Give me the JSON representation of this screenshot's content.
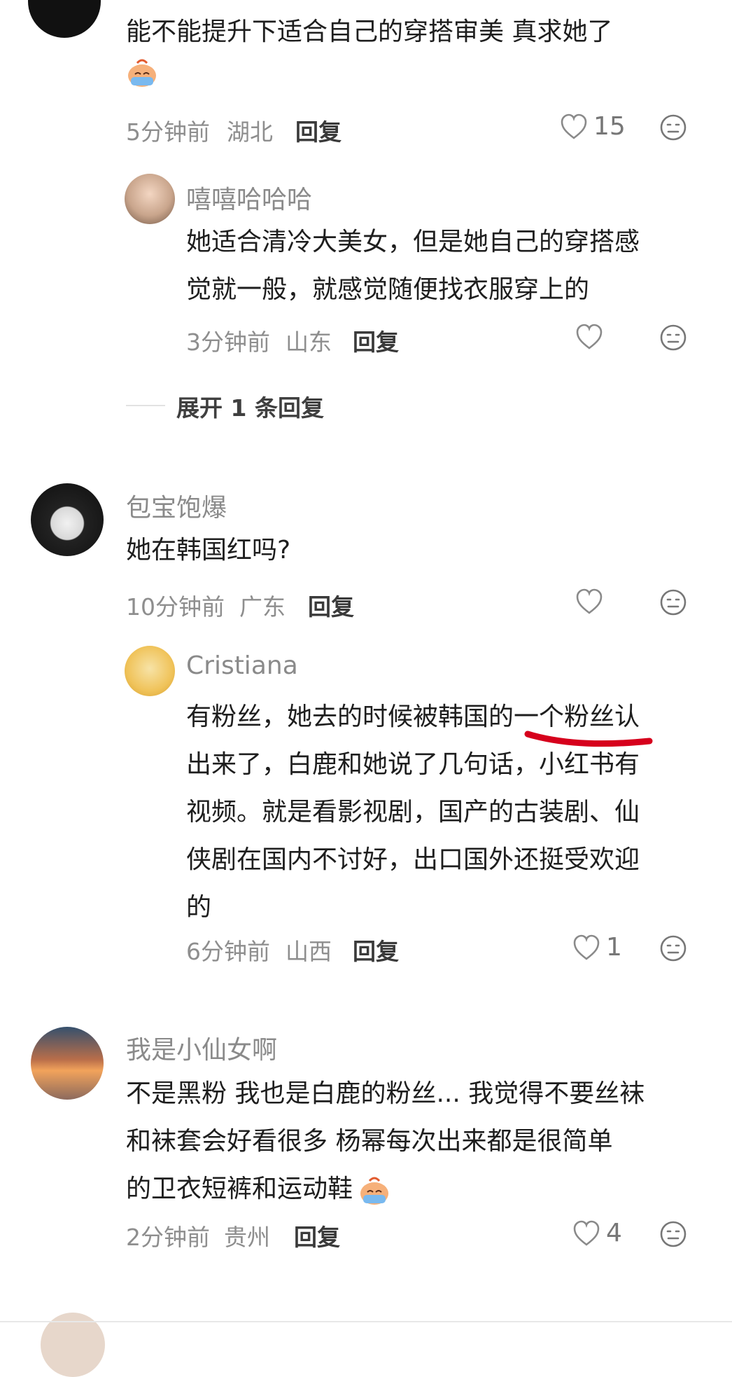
{
  "comments": [
    {
      "text_line1": "能不能提升下适合自己的穿搭审美 真求她了",
      "emoji": "crying-emoji",
      "time": "5分钟前",
      "location": "湖北",
      "reply_label": "回复",
      "likes": "15",
      "replies": [
        {
          "username": "嘻嘻哈哈哈",
          "lines": [
            "她适合清冷大美女，但是她自己的穿搭感",
            "觉就一般，就感觉随便找衣服穿上的"
          ],
          "time": "3分钟前",
          "location": "山东",
          "reply_label": "回复",
          "likes": ""
        }
      ],
      "expand_label": "展开 1 条回复"
    },
    {
      "username": "包宝饱爆",
      "lines": [
        "她在韩国红吗?"
      ],
      "time": "10分钟前",
      "location": "广东",
      "reply_label": "回复",
      "likes": "",
      "replies": [
        {
          "username": "Cristiana",
          "lines": [
            "有粉丝，她去的时候被韩国的一个粉丝认",
            "出来了，白鹿和她说了几句话，小红书有",
            "视频。就是看影视剧，国产的古装剧、仙",
            "侠剧在国内不讨好，出口国外还挺受欢迎",
            "的"
          ],
          "time": "6分钟前",
          "location": "山西",
          "reply_label": "回复",
          "likes": "1"
        }
      ]
    },
    {
      "username": "我是小仙女啊",
      "lines": [
        "不是黑粉 我也是白鹿的粉丝... 我觉得不要丝袜",
        "和袜套会好看很多 杨幂每次出来都是很简单",
        "的卫衣短裤和运动鞋"
      ],
      "emoji": "crying-emoji",
      "time": "2分钟前",
      "location": "贵州",
      "reply_label": "回复",
      "likes": "4"
    }
  ],
  "colors": {
    "highlight_underline": "#d6001c",
    "meta_gray": "#8e8e8e",
    "text": "#1e1e1e"
  }
}
